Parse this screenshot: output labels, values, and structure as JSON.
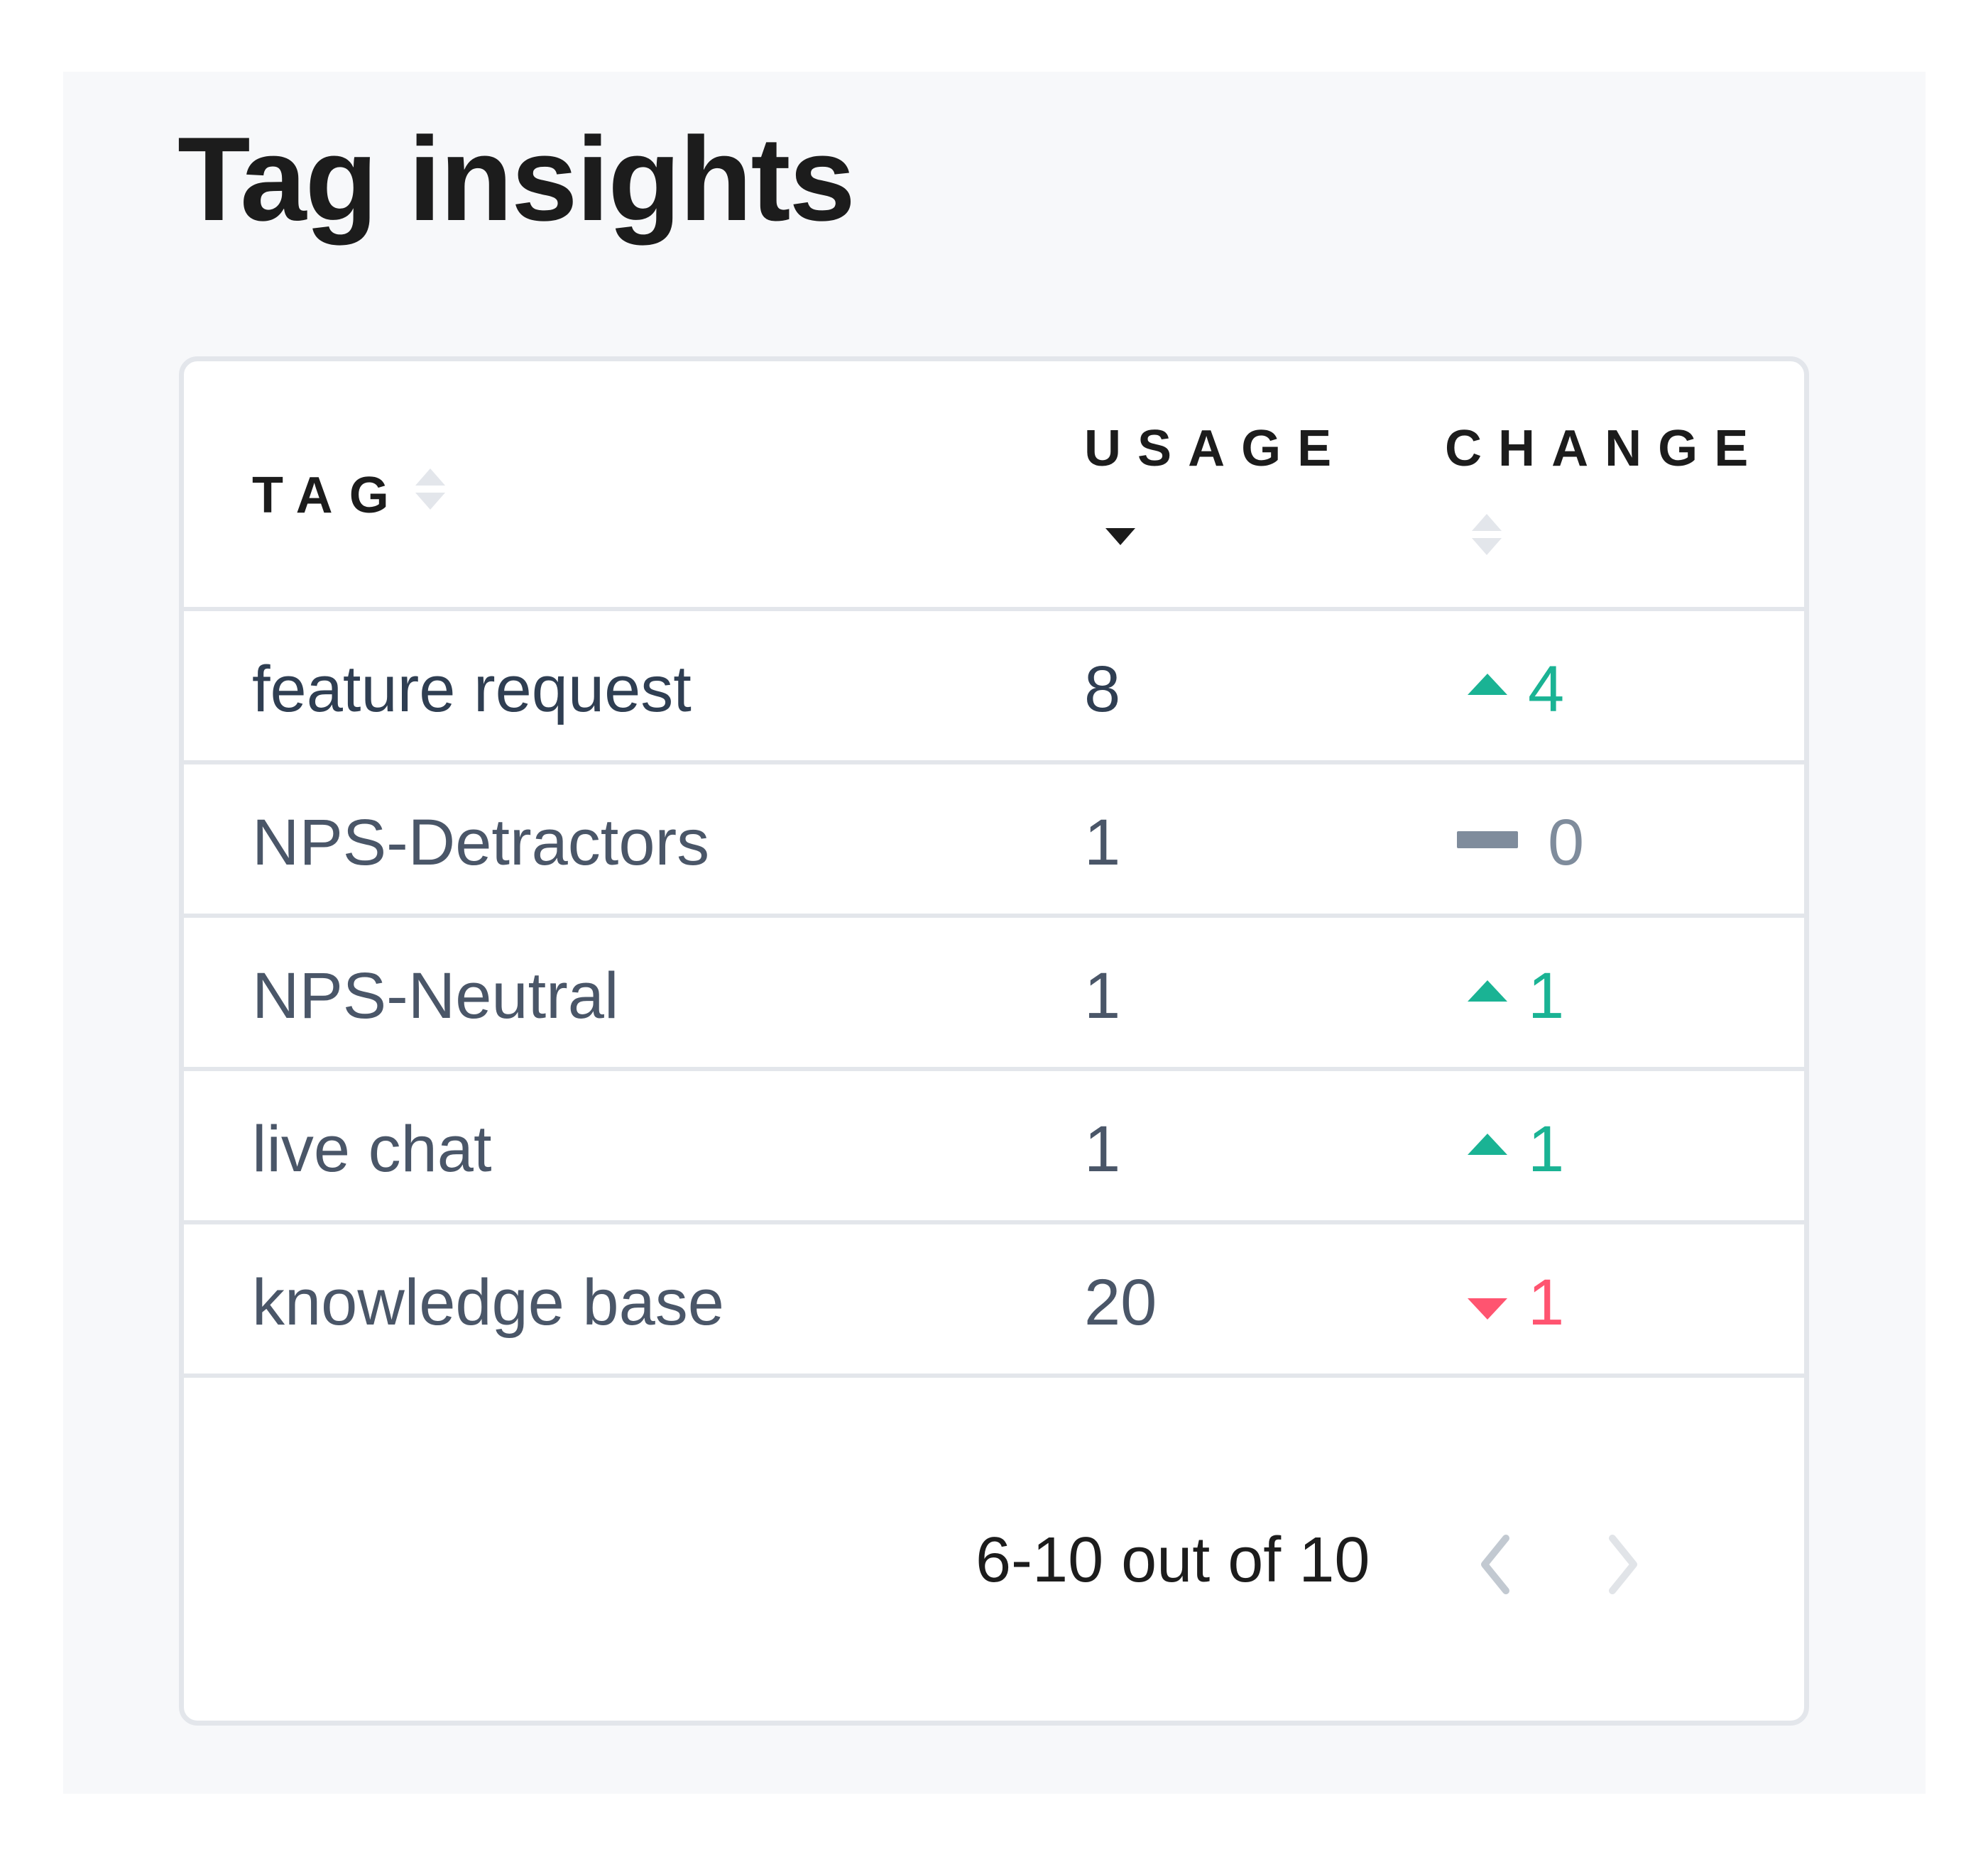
{
  "page": {
    "title": "Tag insights"
  },
  "table": {
    "columns": [
      {
        "label": "TAG",
        "sort": "none"
      },
      {
        "label": "USAGE",
        "sort": "descending"
      },
      {
        "label": "CHANGE",
        "sort": "none"
      }
    ],
    "rows": [
      {
        "tag": "feature request",
        "usage": "8",
        "change": "4",
        "direction": "up"
      },
      {
        "tag": "NPS-Detractors",
        "usage": "1",
        "change": "0",
        "direction": "flat"
      },
      {
        "tag": "NPS-Neutral",
        "usage": "1",
        "change": "1",
        "direction": "up"
      },
      {
        "tag": "live chat",
        "usage": "1",
        "change": "1",
        "direction": "up"
      },
      {
        "tag": "knowledge base",
        "usage": "20",
        "change": "1",
        "direction": "down"
      }
    ]
  },
  "pagination": {
    "range_text": "6-10 out of 10",
    "prev_icon": "chevron-left-icon",
    "next_icon": "chevron-right-icon",
    "prev_enabled": true,
    "next_enabled": false
  },
  "colors": {
    "positive": "#1ab394",
    "negative": "#ff5470",
    "neutral": "#7f8c9c",
    "panel_background": "#f7f8fa",
    "border": "#e3e6eb"
  }
}
